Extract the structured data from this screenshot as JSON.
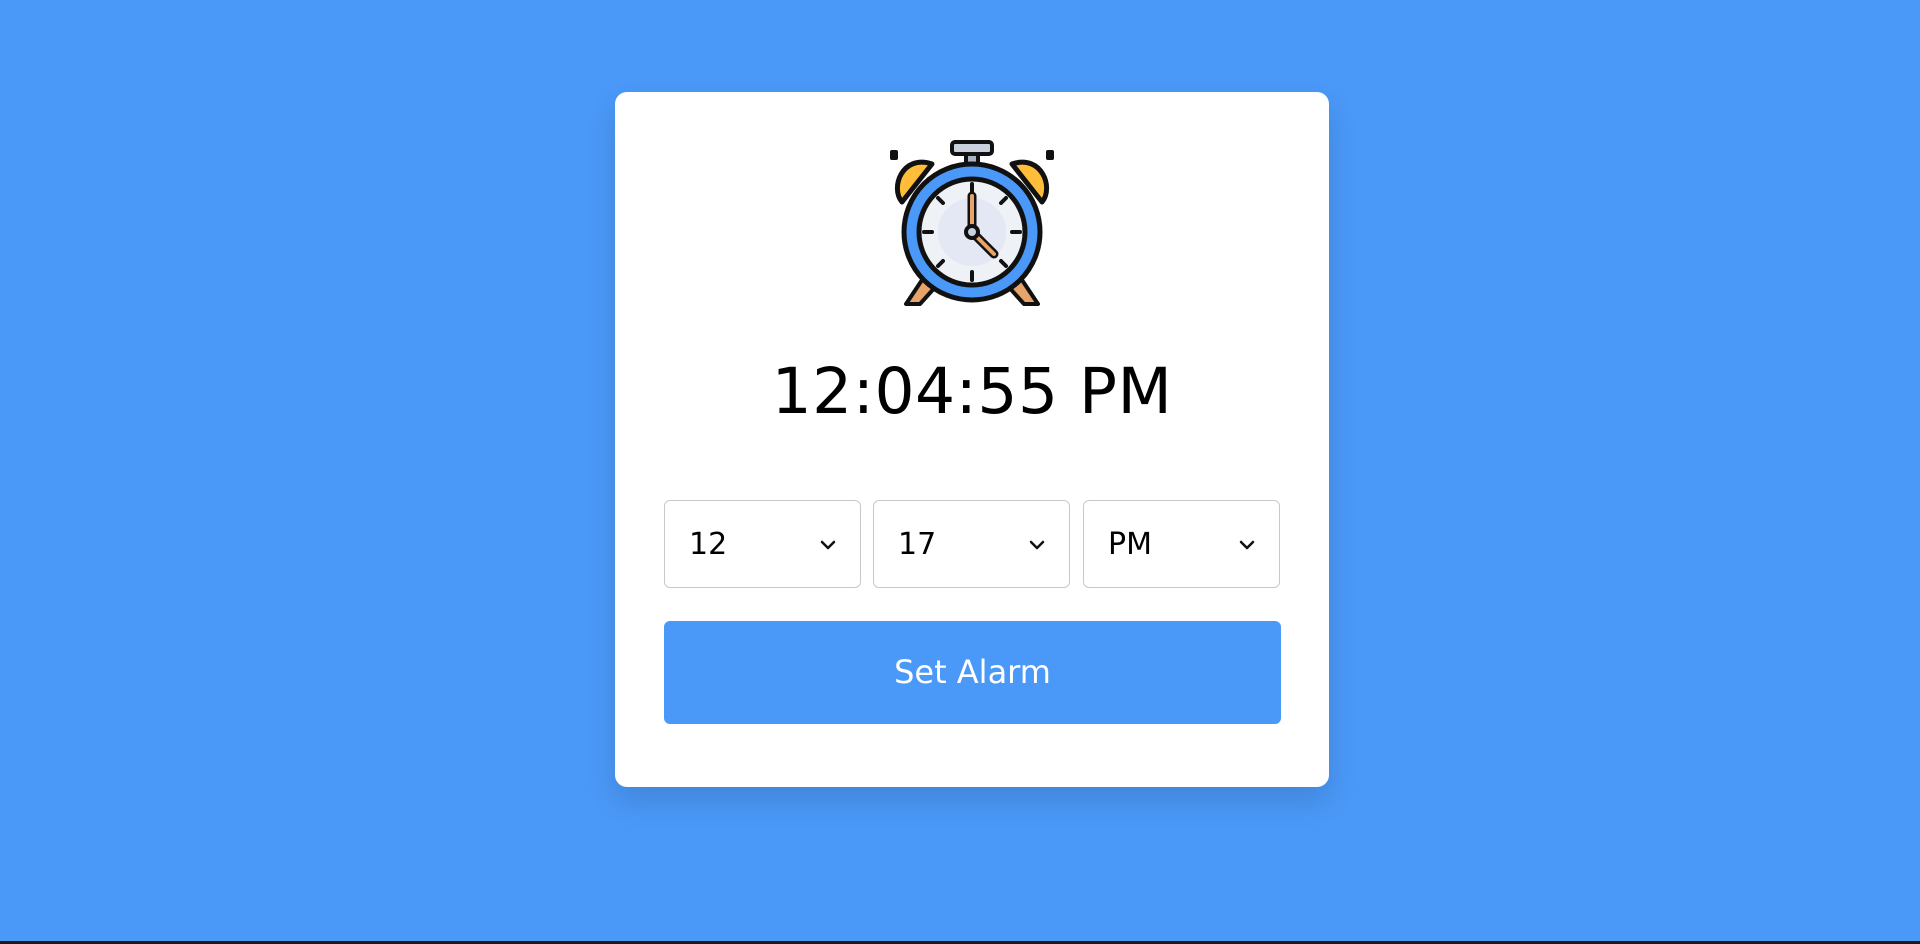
{
  "current_time": "12:04:55 PM",
  "alarm_selects": [
    {
      "value": "12",
      "icon": "chevron-down-icon"
    },
    {
      "value": "17",
      "icon": "chevron-down-icon"
    },
    {
      "value": "PM",
      "icon": "chevron-down-icon"
    }
  ],
  "set_button_label": "Set Alarm",
  "colors": {
    "background": "#4a98f7",
    "card": "#ffffff",
    "accent": "#4a98f7",
    "bell": "#ffbd3a",
    "hand": "#e6a46b"
  },
  "icons": {
    "header": "alarm-clock-icon"
  }
}
